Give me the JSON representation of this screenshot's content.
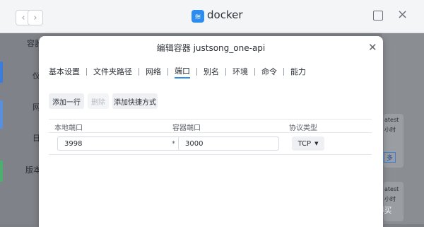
{
  "app": {
    "title": "docker"
  },
  "nav": {
    "back_icon": "chevron-left-icon",
    "forward_icon": "chevron-right-icon"
  },
  "background": {
    "left_items": [
      "容器",
      "仪",
      "网",
      "日",
      "版本"
    ],
    "right_items": [
      "atest",
      "小时",
      "多",
      "atest",
      "小时"
    ]
  },
  "modal": {
    "title": "编辑容器 justsong_one-api",
    "tabs": [
      "基本设置",
      "文件夹路径",
      "网络",
      "端口",
      "别名",
      "环境",
      "命令",
      "能力"
    ],
    "active_tab": "端口",
    "toolbar": {
      "add_row": "添加一行",
      "delete": "删除",
      "add_shortcut": "添加快捷方式"
    },
    "table": {
      "headers": [
        "本地端口",
        "容器端口",
        "协议类型"
      ],
      "rows": [
        {
          "local_port": "3998",
          "separator": "*",
          "container_port": "3000",
          "protocol": "TCP"
        }
      ]
    }
  },
  "watermark": "值 · 什么值得买",
  "colors": {
    "accent": "#2d8cf0"
  }
}
